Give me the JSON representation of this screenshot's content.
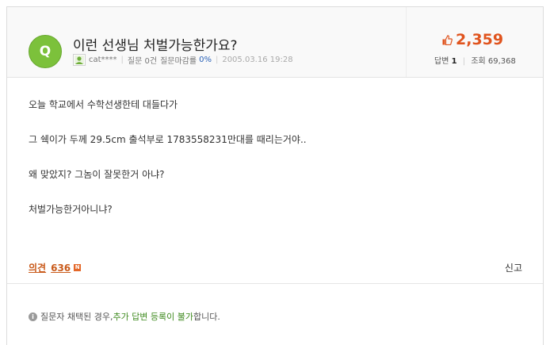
{
  "question": {
    "badge": "Q",
    "title": "이런 선생님 처벌가능한가요?",
    "author": "cat****",
    "answer_stat_label": "질문 0건",
    "closing_rate_label": "질문마감률",
    "closing_rate_value": "0%",
    "date": "2005.03.16 19:28"
  },
  "stats": {
    "likes": "2,359",
    "answers_label": "답변",
    "answers_value": "1",
    "views_label": "조회",
    "views_value": "69,368"
  },
  "body": {
    "lines": [
      "오늘 학교에서 수학선생한테 대들다가",
      "그 쉑이가 두께 29.5cm 출석부로 1783558231만대를 때리는거야..",
      "왜 맞았지? 그놈이 잘못한거 아냐?",
      "처벌가능한거아니냐?"
    ]
  },
  "footer": {
    "opinion_label": "의견",
    "opinion_count": "636",
    "new_badge": "N",
    "report_label": "신고"
  },
  "notice": {
    "icon": "i",
    "prefix": "질문자 채택된 경우, ",
    "highlight": "추가 답변 등록이 불가",
    "suffix": "합니다."
  },
  "colors": {
    "badge_green": "#7cc13b",
    "like_orange": "#e0541e",
    "opinion_orange": "#c95a1a",
    "rate_blue": "#2a62b8",
    "notice_green": "#3f8a1f"
  }
}
